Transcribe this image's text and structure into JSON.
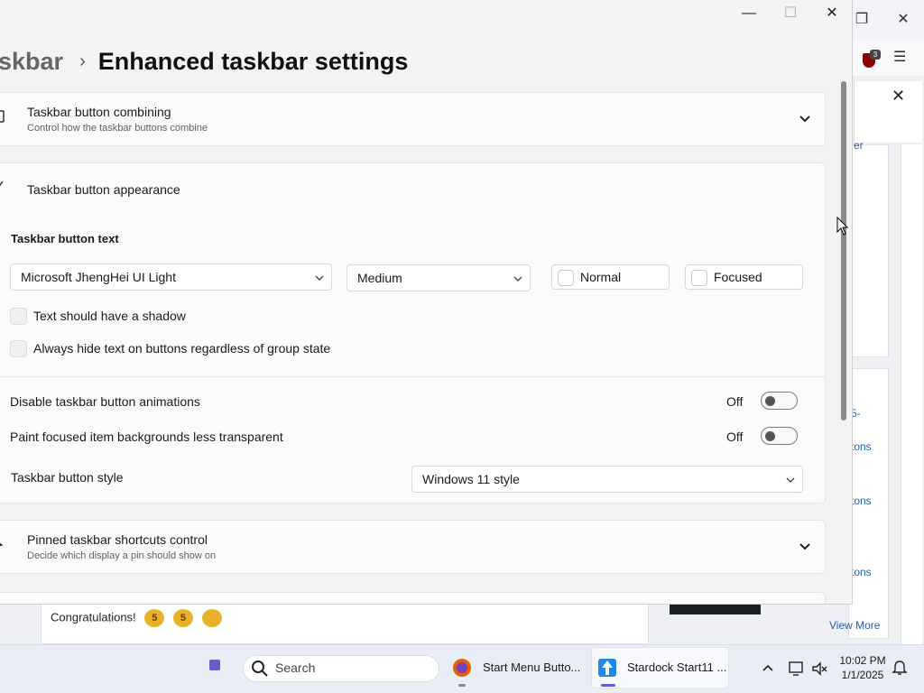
{
  "background_browser": {
    "ublock_badge": "3",
    "side_links": [
      "er",
      "5-",
      "tons",
      "tons",
      "tons"
    ],
    "article_text": "Congratulations!",
    "emoji_labels": [
      "5",
      "5",
      ""
    ],
    "view_more": "View More"
  },
  "settings": {
    "breadcrumb_parent": "skbar",
    "breadcrumb_current": "Enhanced taskbar settings",
    "combining_card": {
      "title": "Taskbar button combining",
      "subtitle": "Control how the taskbar buttons combine"
    },
    "appearance_card": {
      "title": "Taskbar button appearance"
    },
    "button_text": {
      "section_label": "Taskbar button text",
      "font_value": "Microsoft JhengHei UI Light",
      "weight_value": "Medium",
      "normal_label": "Normal",
      "focused_label": "Focused",
      "shadow_label": "Text should have a shadow",
      "hide_text_label": "Always hide text on buttons regardless of group state"
    },
    "animations": {
      "label": "Disable taskbar button animations",
      "state": "Off"
    },
    "transparency": {
      "label": "Paint focused item backgrounds less transparent",
      "state": "Off"
    },
    "button_style": {
      "label": "Taskbar button style",
      "value": "Windows 11 style"
    },
    "pinned_card": {
      "title": "Pinned taskbar shortcuts control",
      "subtitle": "Decide which display a pin should show on"
    }
  },
  "taskbar": {
    "search_placeholder": "Search",
    "apps": [
      {
        "label": "Start Menu Butto..."
      },
      {
        "label": "Stardock Start11 ..."
      }
    ],
    "clock_time": "10:02 PM",
    "clock_date": "1/1/2025",
    "colors": {
      "accent": "#6a5acd",
      "firefox": "#e66000",
      "stardock": "#1e88e5"
    }
  }
}
